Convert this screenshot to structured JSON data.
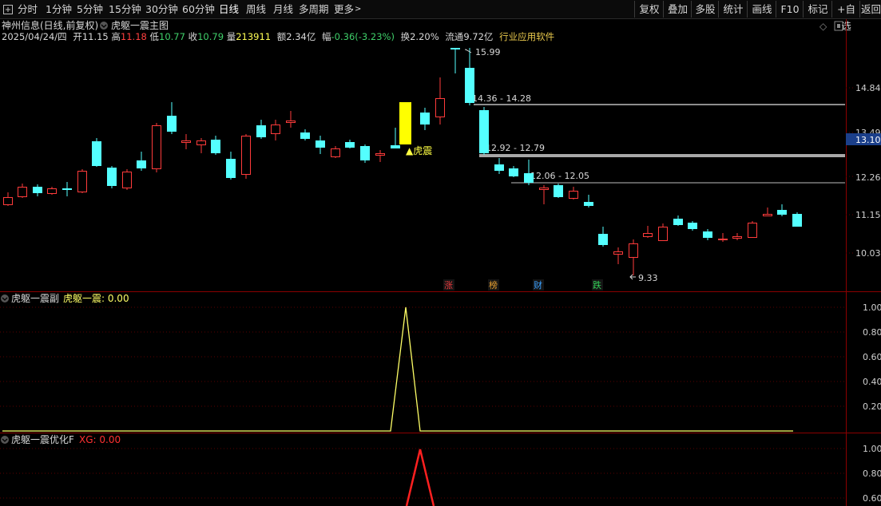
{
  "toolbar": {
    "left": [
      "分时",
      "1分钟",
      "5分钟",
      "15分钟",
      "30分钟",
      "60分钟",
      "日线",
      "周线",
      "月线",
      "多周期",
      "更多"
    ],
    "active": "日线",
    "right": [
      "复权",
      "叠加",
      "多股",
      "统计",
      "画线",
      "F10",
      "标记",
      "+自选",
      "返回"
    ]
  },
  "main_panel": {
    "stock_name": "神州信息(日线,前复权)",
    "indicator_name": "虎躯一震主图",
    "info": {
      "date": "2025/04/24/四",
      "open_label": "开",
      "open": "11.15",
      "high_label": "高",
      "high": "11.18",
      "low_label": "低",
      "low": "10.77",
      "close_label": "收",
      "close": "10.79",
      "volume_label": "量",
      "volume": "213911",
      "amount_label": "额",
      "amount": "2.34亿",
      "change_label": "幅",
      "change": "-0.36(-3.23%)",
      "turnover_label": "换",
      "turnover": "2.20%",
      "float_label": "流通",
      "float": "9.72亿",
      "industry": "行业应用软件"
    },
    "y_ticks": [
      "14.84",
      "13.49",
      "12.26",
      "11.15",
      "10.03"
    ],
    "current_price": "13.10",
    "annotations": {
      "high_marker": "15.99",
      "low_marker": "9.33",
      "signal": "▲虎震",
      "ranges": [
        "14.36 - 14.28",
        "12.92 - 12.79",
        "12.06 - 12.05"
      ],
      "markers": [
        {
          "text": "涨",
          "color": "#e8393c"
        },
        {
          "text": "榜",
          "color": "#e8a030"
        },
        {
          "text": "财",
          "color": "#3aa0ff"
        },
        {
          "text": "跌",
          "color": "#33cc55"
        }
      ]
    },
    "colors": {
      "up": "#ff3b3b",
      "down": "#54ffff",
      "signal": "#ffff00",
      "ma_line": "#bbbbbb"
    }
  },
  "sub_panel1": {
    "title": "虎躯一震副",
    "series_label": "虎躯一震: 0.00",
    "y_ticks": [
      "1.00",
      "0.80",
      "0.60",
      "0.40",
      "0.20"
    ],
    "line_color": "#ffff66"
  },
  "sub_panel2": {
    "title": "虎躯一震优化F",
    "series_label": "XG: 0.00",
    "y_ticks": [
      "1.00",
      "0.80",
      "0.60"
    ],
    "line_color": "#ff2020"
  }
}
